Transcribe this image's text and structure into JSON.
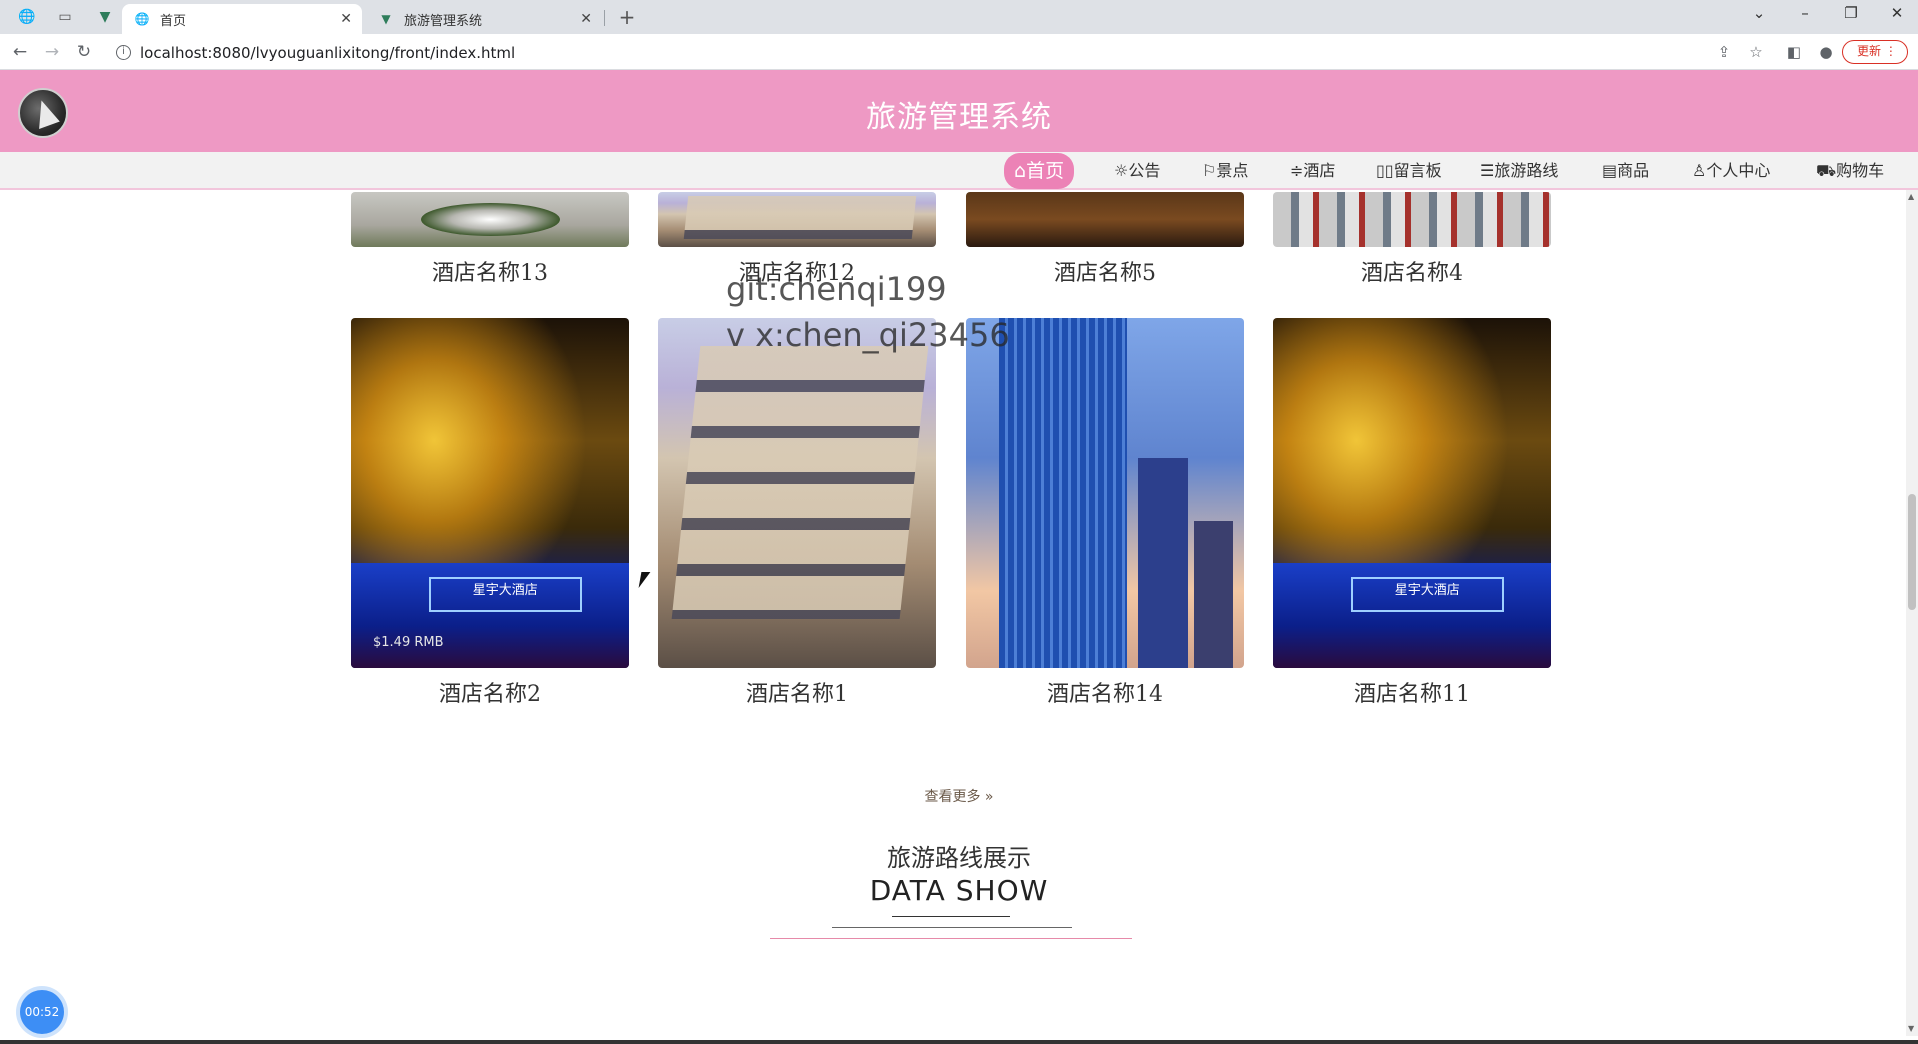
{
  "browser": {
    "tabs": [
      {
        "title": "首页",
        "active": true
      },
      {
        "title": "旅游管理系统",
        "active": false
      }
    ],
    "new_tab": "+",
    "url": "localhost:8080/lvyouguanlixitong/front/index.html",
    "update_label": "更新"
  },
  "site": {
    "title": "旅游管理系统",
    "nav": [
      {
        "label": "首页",
        "icon": "home-icon"
      },
      {
        "label": "公告",
        "icon": "announce-icon"
      },
      {
        "label": "景点",
        "icon": "flag-icon"
      },
      {
        "label": "酒店",
        "icon": "sliders-icon"
      },
      {
        "label": "留言板",
        "icon": "message-icon"
      },
      {
        "label": "旅游路线",
        "icon": "layers-icon"
      },
      {
        "label": "商品",
        "icon": "goods-icon"
      },
      {
        "label": "个人中心",
        "icon": "user-icon"
      },
      {
        "label": "购物车",
        "icon": "cart-icon"
      }
    ]
  },
  "hotels_top": [
    {
      "name": "酒店名称13"
    },
    {
      "name": "酒店名称12"
    },
    {
      "name": "酒店名称5"
    },
    {
      "name": "酒店名称4"
    }
  ],
  "hotels": [
    {
      "name": "酒店名称2"
    },
    {
      "name": "酒店名称1"
    },
    {
      "name": "酒店名称14"
    },
    {
      "name": "酒店名称11"
    }
  ],
  "price_overlay": "$1.49 RMB",
  "hotel_sign": "星宇大酒店",
  "watermark": {
    "line1": "git:chenqi199",
    "line2": "v x:chen_qi23456"
  },
  "more_label": "查看更多 »",
  "section": {
    "title": "旅游路线展示",
    "subtitle": "DATA SHOW"
  },
  "timer": "00:52"
}
